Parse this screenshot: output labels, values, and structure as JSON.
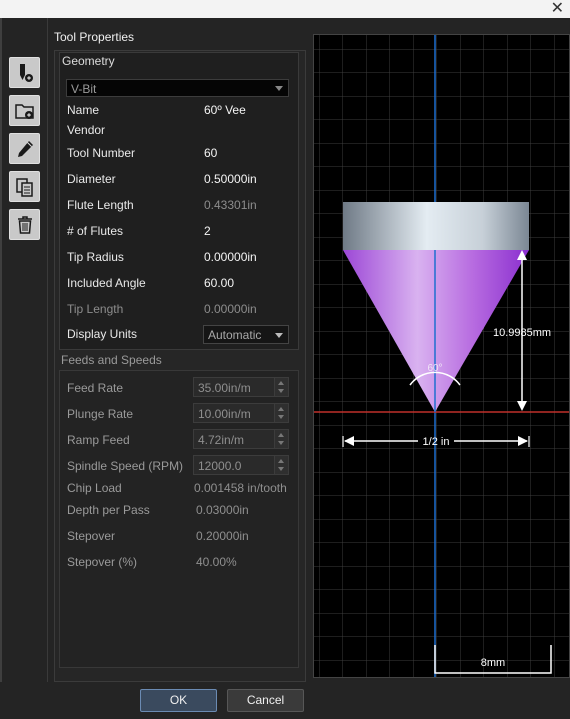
{
  "window": {
    "close_glyph": "✕"
  },
  "panel": {
    "title": "Tool Properties"
  },
  "toolbar": {
    "icons": [
      "new-tool-icon",
      "new-group-icon",
      "edit-icon",
      "copy-icon",
      "delete-icon"
    ]
  },
  "geometry": {
    "title": "Geometry",
    "tool_type": "V-Bit",
    "fields": [
      {
        "label": "Name",
        "value": "60º Vee",
        "dim": false
      },
      {
        "label": "Vendor",
        "value": "",
        "dim": false
      },
      {
        "label": "Tool Number",
        "value": "60",
        "dim": false
      },
      {
        "label": "Diameter",
        "value": "0.50000in",
        "dim": false
      },
      {
        "label": "Flute Length",
        "value": "0.43301in",
        "dim": true
      },
      {
        "label": "# of Flutes",
        "value": "2",
        "dim": false
      },
      {
        "label": "Tip Radius",
        "value": "0.00000in",
        "dim": false
      },
      {
        "label": "Included Angle",
        "value": "60.00",
        "dim": false
      },
      {
        "label": "Tip Length",
        "value": "0.00000in",
        "dim": true
      }
    ],
    "display_units_label": "Display Units",
    "display_units_value": "Automatic"
  },
  "feeds": {
    "title": "Feeds and Speeds",
    "spinners": [
      {
        "label": "Feed Rate",
        "value": "35.00in/m"
      },
      {
        "label": "Plunge Rate",
        "value": "10.00in/m"
      },
      {
        "label": "Ramp Feed",
        "value": "4.72in/m"
      },
      {
        "label": "Spindle Speed (RPM)",
        "value": "12000.0"
      }
    ],
    "readonly": [
      {
        "label": "Chip Load",
        "value": "0.001458 in/tooth"
      },
      {
        "label": "Depth per Pass",
        "value": "0.03000in"
      },
      {
        "label": "Stepover",
        "value": "0.20000in"
      },
      {
        "label": "Stepover (%)",
        "value": "40.00%"
      }
    ]
  },
  "preview": {
    "angle_label": "60°",
    "height_label": "10.9985mm",
    "diameter_label": "1/2 in",
    "scale_label": "8mm",
    "colors": {
      "axis": "#1e6fd0",
      "baseline": "#c0302b",
      "grid": "#3d3d3d",
      "cutter": "#b76be0",
      "shank": "#c6cfd6"
    }
  },
  "buttons": {
    "ok": "OK",
    "cancel": "Cancel"
  }
}
